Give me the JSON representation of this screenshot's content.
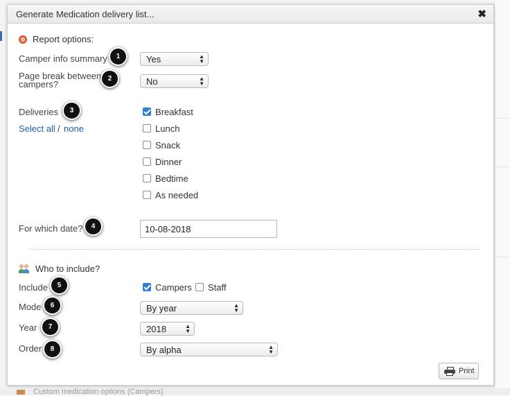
{
  "dialog": {
    "title": "Generate Medication delivery list...",
    "close_glyph": "✖"
  },
  "report_options": {
    "heading": "Report options:",
    "icon": "gear-icon",
    "camper_info_summary": {
      "label": "Camper info summary",
      "value": "Yes"
    },
    "page_break": {
      "label": "Page break between campers?",
      "value": "No"
    },
    "deliveries": {
      "label": "Deliveries",
      "select_all": "Select all",
      "separator": "/",
      "select_none": "none",
      "options": [
        {
          "label": "Breakfast",
          "checked": true
        },
        {
          "label": "Lunch",
          "checked": false
        },
        {
          "label": "Snack",
          "checked": false
        },
        {
          "label": "Dinner",
          "checked": false
        },
        {
          "label": "Bedtime",
          "checked": false
        },
        {
          "label": "As needed",
          "checked": false
        }
      ]
    },
    "date": {
      "label": "For which date?",
      "value": "10-08-2018"
    }
  },
  "who_to_include": {
    "heading": "Who to include?",
    "icon": "people-icon",
    "include": {
      "label": "Include",
      "options": [
        {
          "label": "Campers",
          "checked": true
        },
        {
          "label": "Staff",
          "checked": false
        }
      ]
    },
    "mode": {
      "label": "Mode",
      "value": "By year"
    },
    "year": {
      "label": "Year",
      "value": "2018"
    },
    "order": {
      "label": "Order",
      "value": "By alpha"
    }
  },
  "print_button": {
    "label": "Print",
    "icon": "printer-icon"
  },
  "callouts": [
    "1",
    "2",
    "3",
    "4",
    "5",
    "6",
    "7",
    "8"
  ],
  "background": {
    "bottom_text": "Custom medication options (Campers)"
  },
  "colors": {
    "accent": "#2f7fd8",
    "link": "#1f5fa8",
    "gear": "#e2562e"
  }
}
